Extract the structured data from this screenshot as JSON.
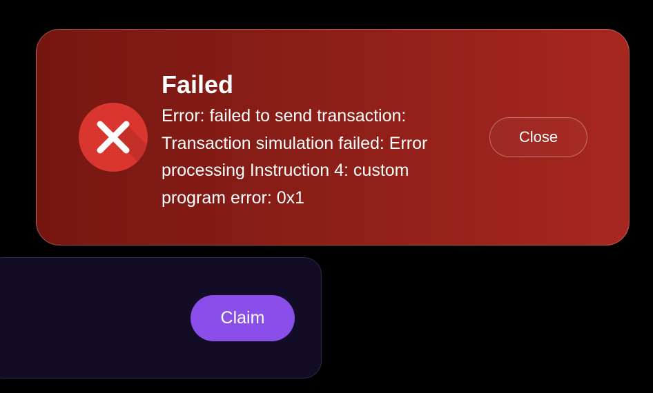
{
  "toast": {
    "status": "error",
    "title": "Failed",
    "message": "Error: failed to send transaction: Transaction simulation failed: Error processing Instruction 4: custom program error: 0x1",
    "close_label": "Close",
    "icon": "x-circle-icon",
    "colors": {
      "background_start": "#761611",
      "background_end": "#a7271f",
      "icon_fill": "#d93630"
    }
  },
  "claim_card": {
    "claim_label": "Claim",
    "colors": {
      "card_background": "#120c26",
      "button": "#8a4fe8"
    }
  }
}
